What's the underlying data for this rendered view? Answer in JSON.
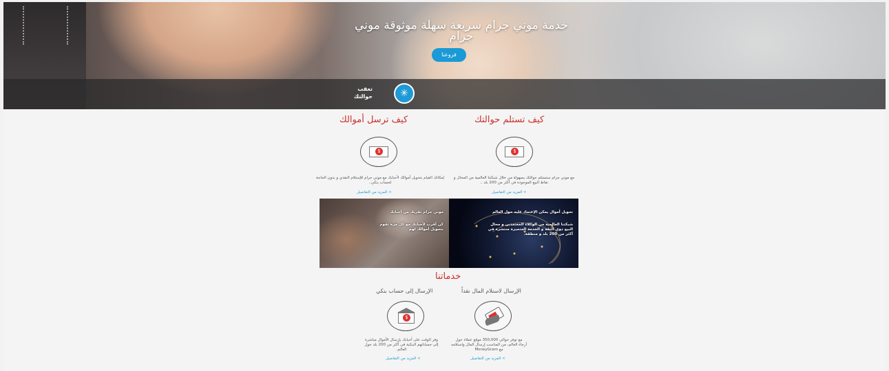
{
  "hero": {
    "title_line1": "خدمة موني جرام  سريعة  سهلة  موثوقة موني",
    "title_line2": "جرام",
    "branches_button": "فروعنا",
    "track_label_line1": "تعقب",
    "track_label_line2": "حوالتك",
    "track_icon": "snowflake-icon"
  },
  "receive": {
    "heading": "كيف تستلم حوالتك",
    "icon": "money-receive-icon",
    "description": "مع موني جرام ستستلم حوالتك بسهولة من خلال شبكتنا العالمية من المحال و نقاط البيع الموجودة في أكثر من 200 بلد ..",
    "more": "> المزيد من التفاصيل"
  },
  "send": {
    "heading": "كيف ترسل أموالك",
    "icon": "money-send-icon",
    "description": "إمكانك القيام بتحويل أموالك لأحبابك مع موني جرام للإستلام النقدي و بدون الحاجة لحساب بنكي..",
    "more": "> المزيد من التفاصيل"
  },
  "photos": {
    "right_title": "تحويل أموال يمكن الإعتماد عليه حول العالم",
    "right_body": "شبكتنا العالمية من الوكلاء المعتمدين و محال البيع ذوي الثقة و الخدمة المتميزة منتشرة في أكثر من 200 بلد و منطقة.",
    "left_title": "موني جرام تقربك من أحبابك",
    "left_body": "كن أقرب لأحبابك مع كل مرة تقوم بتحويل أموالك لهم"
  },
  "services": {
    "heading": "خدماتنا",
    "cash": {
      "title": "الإرسال لاستلام المال نقداً",
      "icon": "hand-cash-icon",
      "description": "مع توفر حوالي 350,000 موقع عملاء حول أرجاء العالم، من المناسب إرسال المال واستلامه مع MoneyGram",
      "more": "> المزيد من التفاصيل"
    },
    "bank": {
      "title": "الإرسال إلى حساب بنكي",
      "icon": "bank-icon",
      "description": "وفر الوقت على أحبابك بإرسال الأموال مباشرة إلى حساباتهم البنكية في أكثر من 200 بلد حول العالم.",
      "more": "> المزيد من التفاصيل"
    }
  }
}
